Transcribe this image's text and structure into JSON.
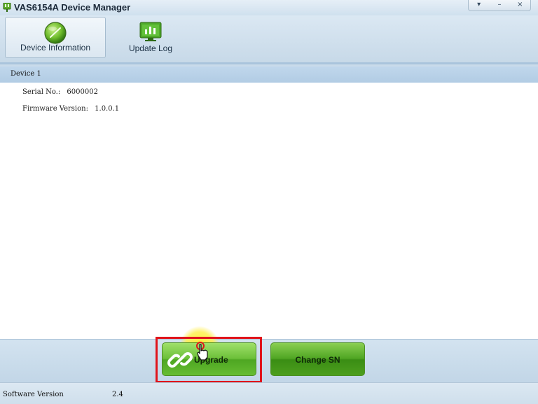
{
  "window": {
    "title": "VAS6154A Device Manager",
    "app_icon": "plug-icon",
    "controls": [
      {
        "name": "menu-dropdown-icon",
        "glyph": "▾"
      },
      {
        "name": "minimize-icon",
        "glyph": "–"
      },
      {
        "name": "close-icon",
        "glyph": "×"
      }
    ]
  },
  "toolbar": {
    "tabs": [
      {
        "label": "Device Information",
        "icon": "globe-icon",
        "active": true
      },
      {
        "label": "Update Log",
        "icon": "bar-chart-monitor-icon",
        "active": false
      }
    ]
  },
  "device": {
    "title": "Device 1",
    "serial_label": "Serial No.:",
    "serial_value": "6000002",
    "firmware_label": "Firmware Version:",
    "firmware_value": "1.0.0.1"
  },
  "actions": {
    "upgrade_label": "Upgrade",
    "upgrade_icon": "link-icon",
    "change_sn_label": "Change SN"
  },
  "status": {
    "software_version_label": "Software Version",
    "software_version_value": "2.4"
  },
  "colors": {
    "highlight": "#e0141b",
    "button_green": "#4ea622",
    "header_blue": "#b2cce4"
  }
}
